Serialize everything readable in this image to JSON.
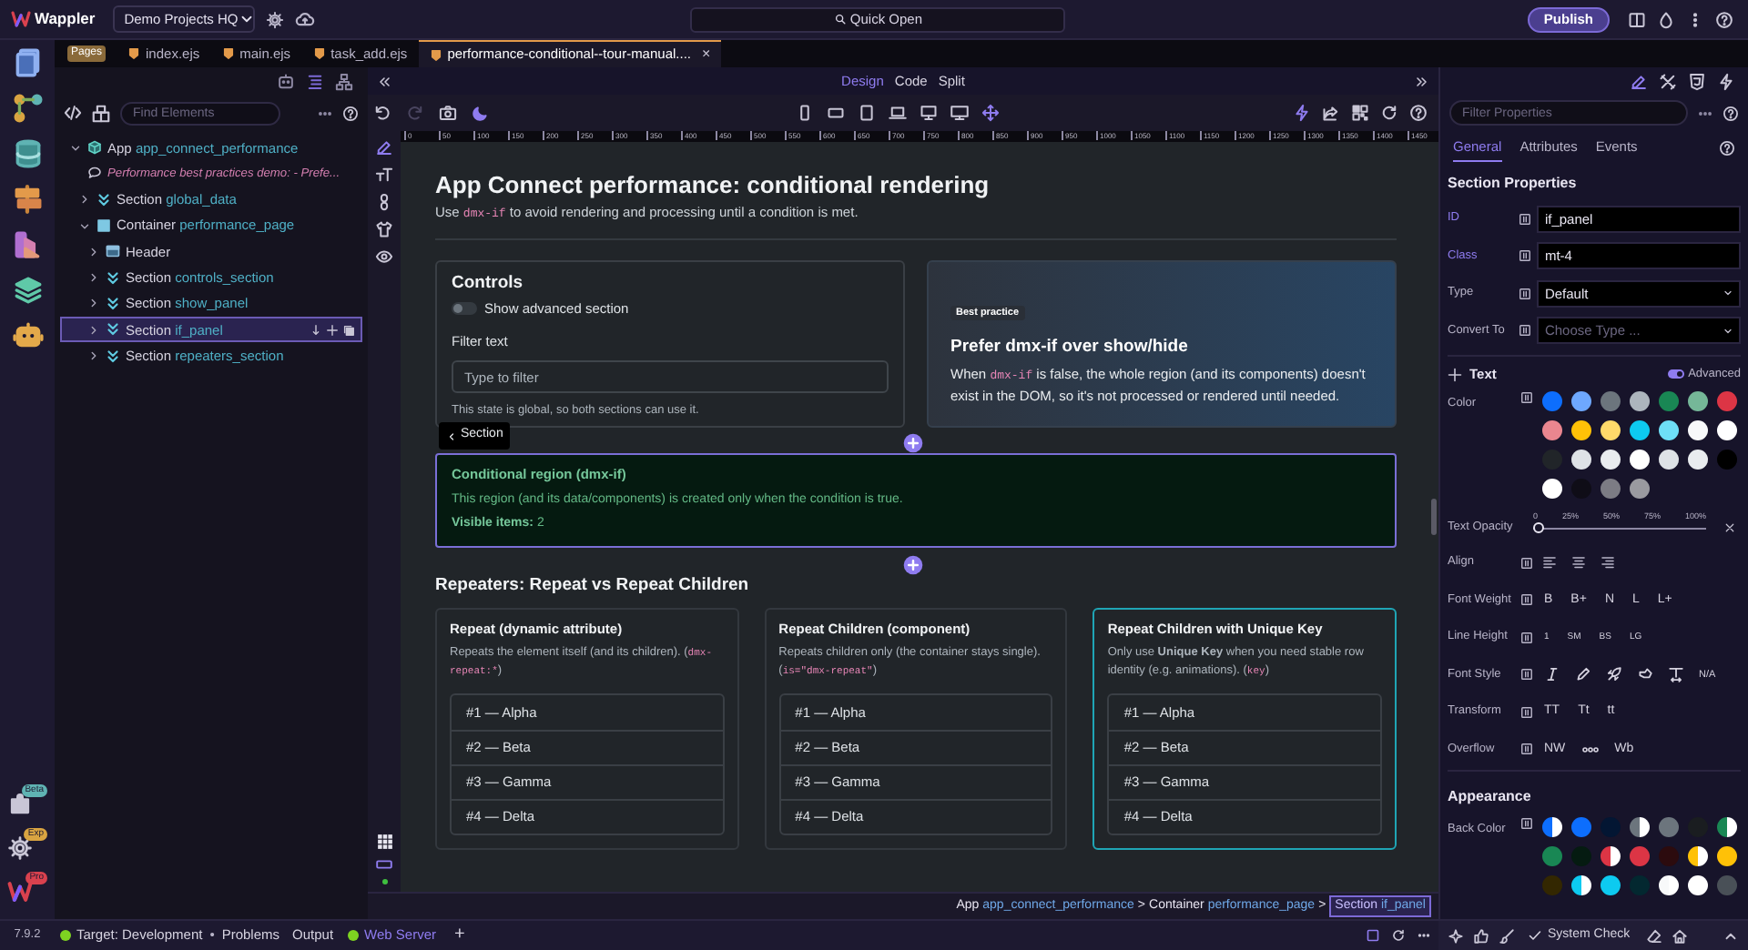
{
  "app": {
    "name": "Wappler",
    "project": "Demo Projects HQ",
    "quick_open": "Quick Open",
    "publish": "Publish"
  },
  "activity_badges": [
    {
      "label": "Beta",
      "color": "#5fb3b3"
    },
    {
      "label": "Exp",
      "color": "#d9a441"
    },
    {
      "label": "Pro",
      "color": "#d9414e"
    }
  ],
  "tabs": {
    "group_label": "Pages",
    "items": [
      {
        "label": "index.ejs",
        "selected": false
      },
      {
        "label": "main.ejs",
        "selected": false
      },
      {
        "label": "task_add.ejs",
        "selected": false
      },
      {
        "label": "performance-conditional--tour-manual....",
        "selected": true,
        "close": "×"
      }
    ]
  },
  "structure": {
    "search_placeholder": "Find Elements",
    "tree": [
      {
        "kind": "app",
        "type": "App",
        "name": "app_connect_performance",
        "expanded": true,
        "selected": false,
        "children": [
          {
            "kind": "comment",
            "text": "Performance best practices demo: - Prefe...",
            "selected": false
          },
          {
            "kind": "section",
            "type": "Section",
            "name": "global_data",
            "expanded": false,
            "selected": false
          },
          {
            "kind": "container",
            "type": "Container",
            "name": "performance_page",
            "expanded": true,
            "selected": false,
            "children": [
              {
                "kind": "header",
                "type": "Header",
                "expanded": false,
                "selected": false
              },
              {
                "kind": "section",
                "type": "Section",
                "name": "controls_section",
                "expanded": false,
                "selected": false
              },
              {
                "kind": "section",
                "type": "Section",
                "name": "show_panel",
                "expanded": false,
                "selected": false
              },
              {
                "kind": "section",
                "type": "Section",
                "name": "if_panel",
                "expanded": false,
                "selected": true
              },
              {
                "kind": "section",
                "type": "Section",
                "name": "repeaters_section",
                "expanded": false,
                "selected": false
              }
            ]
          }
        ]
      }
    ]
  },
  "view_modes": [
    {
      "label": "Design",
      "selected": true
    },
    {
      "label": "Code",
      "selected": false
    },
    {
      "label": "Split",
      "selected": false
    }
  ],
  "ruler": {
    "labels": [
      "0",
      "50",
      "100",
      "150",
      "200",
      "250",
      "300",
      "350",
      "400",
      "450",
      "500",
      "550",
      "600",
      "650",
      "700",
      "750",
      "800",
      "850",
      "900",
      "950",
      "1000",
      "1050",
      "1100",
      "1150",
      "1200",
      "1250",
      "1300",
      "1350",
      "1400",
      "1450"
    ]
  },
  "page": {
    "title": "App Connect performance: conditional rendering",
    "subtitle": [
      {
        "kind": "text",
        "text": "Use "
      },
      {
        "kind": "code",
        "text": "dmx-if"
      },
      {
        "kind": "text",
        "text": " to avoid rendering and processing until a condition is met."
      }
    ],
    "controls": {
      "title": "Controls",
      "toggle": {
        "label": "Show advanced section",
        "on": false
      },
      "field_label": "Filter text",
      "placeholder": "Type to filter",
      "help": "This state is global, so both sections can use it."
    },
    "best_practice": {
      "badge": "Best practice",
      "title": "Prefer dmx-if over show/hide",
      "body": [
        {
          "kind": "text",
          "text": "When "
        },
        {
          "kind": "code",
          "text": "dmx-if"
        },
        {
          "kind": "text",
          "text": " is false, the whole region (and its components) doesn't exist in the DOM, so it's not processed or rendered until needed."
        }
      ]
    },
    "section_tag": "Section",
    "conditional": {
      "title": "Conditional region (dmx-if)",
      "text": "This region (and its data/components) is created only when the condition is true.",
      "count_label": "Visible items:",
      "count": "2"
    },
    "repeaters": {
      "title": "Repeaters: Repeat vs Repeat Children",
      "cards": [
        {
          "title": "Repeat (dynamic attribute)",
          "selected": false,
          "description": [
            {
              "kind": "text",
              "text": "Repeats the element itself (and its children). ("
            },
            {
              "kind": "code",
              "text": "dmx-repeat:*"
            },
            {
              "kind": "text",
              "text": ")"
            }
          ],
          "items": [
            "#1 — Alpha",
            "#2 — Beta",
            "#3 — Gamma",
            "#4 — Delta"
          ]
        },
        {
          "title": "Repeat Children (component)",
          "selected": false,
          "description": [
            {
              "kind": "text",
              "text": "Repeats children only (the container stays single). ("
            },
            {
              "kind": "code",
              "text": "is=\"dmx-repeat\""
            },
            {
              "kind": "text",
              "text": ")"
            }
          ],
          "items": [
            "#1 — Alpha",
            "#2 — Beta",
            "#3 — Gamma",
            "#4 — Delta"
          ]
        },
        {
          "title": "Repeat Children with Unique Key",
          "selected": true,
          "description": [
            {
              "kind": "text",
              "text": "Only use **Unique Key** when you need stable row identity (e.g. animations). ("
            },
            {
              "kind": "code",
              "text": "key"
            },
            {
              "kind": "text",
              "text": ")"
            }
          ],
          "items": [
            "#1 — Alpha",
            "#2 — Beta",
            "#3 — Gamma",
            "#4 — Delta"
          ]
        }
      ]
    }
  },
  "breadcrumb": {
    "separator": ">",
    "items": [
      {
        "type": "App",
        "name": "app_connect_performance",
        "selected": false
      },
      {
        "type": "Container",
        "name": "performance_page",
        "selected": false
      },
      {
        "type": "Section",
        "name": "if_panel",
        "selected": true
      }
    ]
  },
  "properties": {
    "filter_placeholder": "Filter Properties",
    "tabs": [
      {
        "label": "General",
        "selected": true
      },
      {
        "label": "Attributes",
        "selected": false
      },
      {
        "label": "Events",
        "selected": false
      }
    ],
    "title": "Section Properties",
    "fields": [
      {
        "kind": "input",
        "label": "ID",
        "value": "if_panel",
        "set": true
      },
      {
        "kind": "input",
        "label": "Class",
        "value": "mt-4",
        "set": true
      },
      {
        "kind": "select",
        "label": "Type",
        "value": "Default",
        "set": false
      },
      {
        "kind": "select",
        "label": "Convert To",
        "placeholder": "Choose Type ...",
        "set": false
      }
    ],
    "text_group": {
      "title": "Text",
      "advanced": {
        "label": "Advanced",
        "on": true
      },
      "color_label": "Color",
      "colors": [
        {
          "color": "#0d6efd"
        },
        {
          "color": "#6ea8fe"
        },
        {
          "color": "#6c757d"
        },
        {
          "color": "#adb5bd"
        },
        {
          "color": "#198754"
        },
        {
          "color": "#75b798"
        },
        {
          "color": "#dc3545"
        },
        {
          "color": "#ea868f"
        },
        {
          "color": "#ffc107"
        },
        {
          "color": "#ffda6a"
        },
        {
          "color": "#0dcaf0"
        },
        {
          "color": "#6edff6"
        },
        {
          "color": "#f8f9fa"
        },
        {
          "color": "#ffffff"
        },
        {
          "color": "#212529"
        },
        {
          "color": "#dee2e6"
        },
        {
          "color": "#e9ecef"
        },
        {
          "color": "#ffffff"
        },
        {
          "color": "#dee2e6"
        },
        {
          "color": "#e9ecef"
        },
        {
          "color": "#000000"
        },
        {
          "color": "#ffffff"
        },
        {
          "color": "#0f0d17"
        },
        {
          "color": "#7c7c84"
        },
        {
          "color": "#9a9aa0"
        }
      ],
      "opacity": {
        "label": "Text Opacity",
        "marks": [
          "0",
          "25%",
          "50%",
          "75%",
          "100%"
        ],
        "level": 0
      },
      "align_label": "Align",
      "weight": {
        "label": "Font Weight",
        "options": [
          "B",
          "B+",
          "N",
          "L",
          "L+"
        ]
      },
      "line_height": {
        "label": "Line Height",
        "options": [
          "1",
          "SM",
          "BS",
          "LG"
        ]
      },
      "font_style": {
        "label": "Font Style",
        "options": [
          {
            "kind": "italic"
          },
          {
            "kind": "pen"
          },
          {
            "kind": "rocket"
          },
          {
            "kind": "hand"
          },
          {
            "kind": "spacing"
          },
          {
            "kind": "text",
            "label": "N/A"
          }
        ]
      },
      "transform": {
        "label": "Transform",
        "options": [
          "TT",
          "Tt",
          "tt"
        ]
      },
      "overflow": {
        "label": "Overflow",
        "options": [
          {
            "kind": "text",
            "label": "NW"
          },
          {
            "kind": "dots"
          },
          {
            "kind": "text",
            "label": "Wb"
          }
        ]
      }
    },
    "appearance": {
      "title": "Appearance",
      "back_color_label": "Back Color",
      "colors": [
        {
          "kind": "half",
          "color": "#0d6efd"
        },
        {
          "kind": "solid",
          "color": "#0d6efd"
        },
        {
          "kind": "solid",
          "color": "#031633"
        },
        {
          "kind": "half",
          "color": "#6c757d"
        },
        {
          "kind": "solid",
          "color": "#6c757d"
        },
        {
          "kind": "solid",
          "color": "#1a1d20"
        },
        {
          "kind": "half",
          "color": "#198754"
        },
        {
          "kind": "solid",
          "color": "#198754"
        },
        {
          "kind": "solid",
          "color": "#051b11"
        },
        {
          "kind": "half",
          "color": "#dc3545"
        },
        {
          "kind": "solid",
          "color": "#dc3545"
        },
        {
          "kind": "solid",
          "color": "#2c0b0e"
        },
        {
          "kind": "half",
          "color": "#ffc107"
        },
        {
          "kind": "solid",
          "color": "#ffc107"
        },
        {
          "kind": "solid",
          "color": "#332701"
        },
        {
          "kind": "half",
          "color": "#0dcaf0"
        },
        {
          "kind": "solid",
          "color": "#0dcaf0"
        },
        {
          "kind": "solid",
          "color": "#032830"
        },
        {
          "kind": "half",
          "color": "#f8f9fa"
        },
        {
          "kind": "solid",
          "color": "#ffffff"
        },
        {
          "kind": "solid",
          "color": "#495057"
        }
      ]
    }
  },
  "status_bar": {
    "version": "7.9.2",
    "target": "Target: Development",
    "bullet": "•",
    "problems": "Problems",
    "output": "Output",
    "server": "Web Server",
    "add": "+",
    "system_check": "System Check"
  }
}
